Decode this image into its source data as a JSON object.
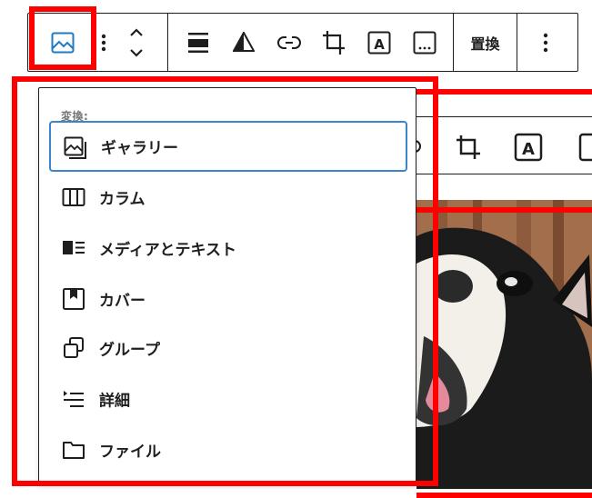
{
  "toolbar": {
    "replace_label": "置換"
  },
  "transform_menu": {
    "heading": "変換:",
    "items": [
      {
        "label": "ギャラリー",
        "icon": "gallery-icon",
        "active": true
      },
      {
        "label": "カラム",
        "icon": "columns-icon"
      },
      {
        "label": "メディアとテキスト",
        "icon": "media-text-icon"
      },
      {
        "label": "カバー",
        "icon": "cover-icon"
      },
      {
        "label": "グループ",
        "icon": "group-icon"
      },
      {
        "label": "詳細",
        "icon": "details-icon"
      },
      {
        "label": "ファイル",
        "icon": "file-icon"
      }
    ]
  },
  "colors": {
    "highlight": "#ff0000",
    "focus_blue": "#3a86c8",
    "image_icon_blue": "#1f7ac4"
  }
}
